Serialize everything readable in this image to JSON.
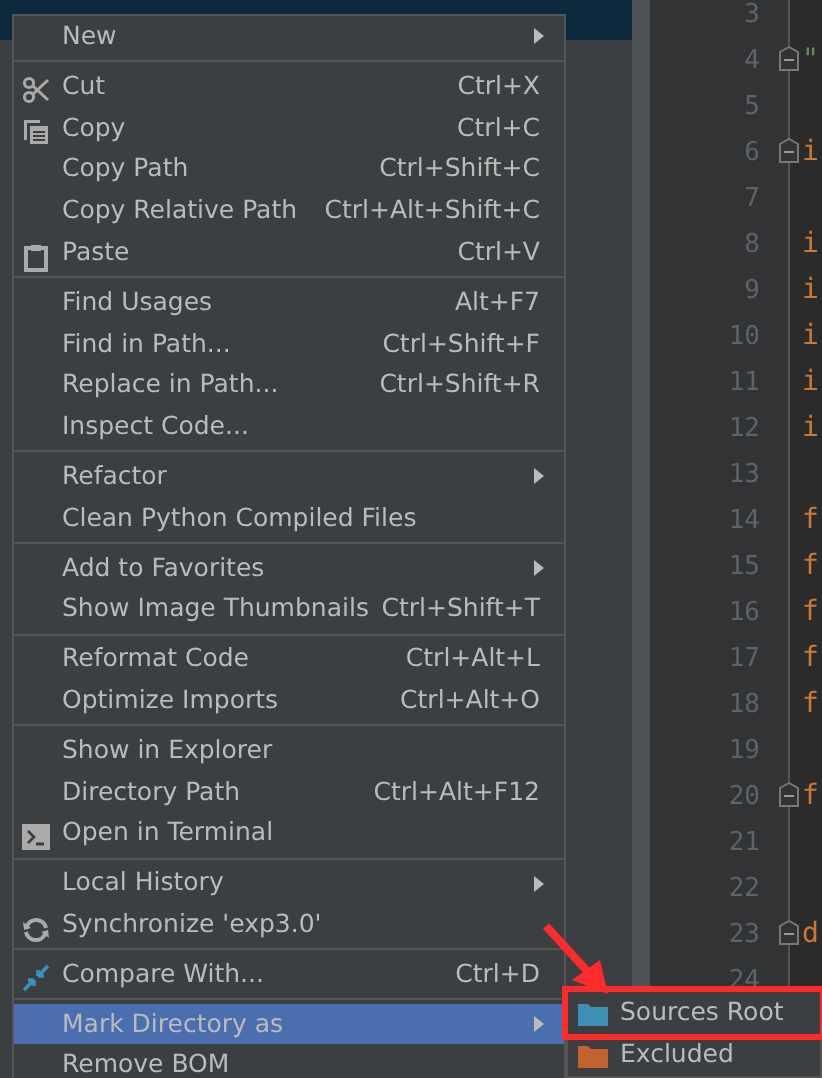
{
  "editor": {
    "lines": [
      {
        "number": "3",
        "fold": false
      },
      {
        "number": "4",
        "code": "\"",
        "kind": "string",
        "fold": true
      },
      {
        "number": "5",
        "fold": false
      },
      {
        "number": "6",
        "code": "i",
        "kind": "keyword",
        "fold": true
      },
      {
        "number": "7",
        "fold": false
      },
      {
        "number": "8",
        "code": "i",
        "kind": "keyword",
        "fold": false
      },
      {
        "number": "9",
        "code": "i",
        "kind": "keyword",
        "fold": false
      },
      {
        "number": "10",
        "code": "i",
        "kind": "keyword",
        "fold": false
      },
      {
        "number": "11",
        "code": "i",
        "kind": "keyword",
        "fold": false
      },
      {
        "number": "12",
        "code": "i",
        "kind": "keyword",
        "fold": false
      },
      {
        "number": "13",
        "fold": false
      },
      {
        "number": "14",
        "code": "f",
        "kind": "keyword",
        "fold": false
      },
      {
        "number": "15",
        "code": "f",
        "kind": "keyword",
        "fold": false
      },
      {
        "number": "16",
        "code": "f",
        "kind": "keyword",
        "fold": false
      },
      {
        "number": "17",
        "code": "f",
        "kind": "keyword",
        "fold": false
      },
      {
        "number": "18",
        "code": "f",
        "kind": "keyword",
        "fold": false
      },
      {
        "number": "19",
        "fold": false
      },
      {
        "number": "20",
        "code": "f",
        "kind": "keyword",
        "fold": true
      },
      {
        "number": "21",
        "fold": false
      },
      {
        "number": "22",
        "fold": false
      },
      {
        "number": "23",
        "code": "d",
        "kind": "keyword",
        "fold": true
      },
      {
        "number": "24",
        "fold": false
      }
    ]
  },
  "context_menu": {
    "items": [
      {
        "kind": "item",
        "label": "New",
        "submenu": true,
        "selected": false
      },
      {
        "kind": "separator"
      },
      {
        "kind": "item",
        "label": "Cut",
        "shortcut": "Ctrl+X",
        "selected": false
      },
      {
        "kind": "item",
        "label": "Copy",
        "shortcut": "Ctrl+C",
        "selected": false
      },
      {
        "kind": "item",
        "label": "Copy Path",
        "shortcut": "Ctrl+Shift+C",
        "selected": false
      },
      {
        "kind": "item",
        "label": "Copy Relative Path",
        "shortcut": "Ctrl+Alt+Shift+C",
        "selected": false
      },
      {
        "kind": "item",
        "label": "Paste",
        "shortcut": "Ctrl+V",
        "selected": false
      },
      {
        "kind": "separator"
      },
      {
        "kind": "item",
        "label": "Find Usages",
        "shortcut": "Alt+F7",
        "selected": false
      },
      {
        "kind": "item",
        "label": "Find in Path...",
        "shortcut": "Ctrl+Shift+F",
        "selected": false
      },
      {
        "kind": "item",
        "label": "Replace in Path...",
        "shortcut": "Ctrl+Shift+R",
        "selected": false
      },
      {
        "kind": "item",
        "label": "Inspect Code...",
        "selected": false
      },
      {
        "kind": "separator"
      },
      {
        "kind": "item",
        "label": "Refactor",
        "submenu": true,
        "selected": false
      },
      {
        "kind": "item",
        "label": "Clean Python Compiled Files",
        "selected": false
      },
      {
        "kind": "separator"
      },
      {
        "kind": "item",
        "label": "Add to Favorites",
        "submenu": true,
        "selected": false
      },
      {
        "kind": "item",
        "label": "Show Image Thumbnails",
        "shortcut": "Ctrl+Shift+T",
        "selected": false
      },
      {
        "kind": "separator"
      },
      {
        "kind": "item",
        "label": "Reformat Code",
        "shortcut": "Ctrl+Alt+L",
        "selected": false
      },
      {
        "kind": "item",
        "label": "Optimize Imports",
        "shortcut": "Ctrl+Alt+O",
        "selected": false
      },
      {
        "kind": "separator"
      },
      {
        "kind": "item",
        "label": "Show in Explorer",
        "selected": false
      },
      {
        "kind": "item",
        "label": "Directory Path",
        "shortcut": "Ctrl+Alt+F12",
        "selected": false
      },
      {
        "kind": "item",
        "label": "Open in Terminal",
        "selected": false
      },
      {
        "kind": "separator"
      },
      {
        "kind": "item",
        "label": "Local History",
        "submenu": true,
        "selected": false
      },
      {
        "kind": "item",
        "label": "Synchronize 'exp3.0'",
        "selected": false
      },
      {
        "kind": "separator"
      },
      {
        "kind": "item",
        "label": "Compare With...",
        "shortcut": "Ctrl+D",
        "selected": false
      },
      {
        "kind": "separator"
      },
      {
        "kind": "item",
        "label": "Mark Directory as",
        "submenu": true,
        "selected": true
      },
      {
        "kind": "item",
        "label": "Remove BOM",
        "selected": false
      }
    ]
  },
  "submenu": {
    "items": [
      {
        "label": "Sources Root",
        "color": "#3d8fb4",
        "highlighted": true
      },
      {
        "label": "Excluded",
        "color": "#c2622d",
        "highlighted": false
      }
    ]
  }
}
